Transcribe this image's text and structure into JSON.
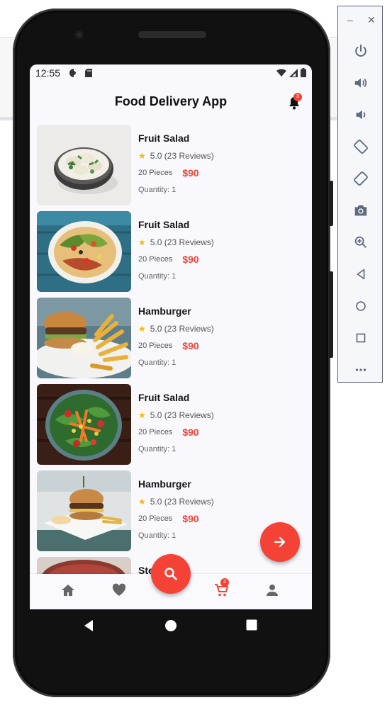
{
  "status_bar": {
    "time": "12:55"
  },
  "app": {
    "title": "Food Delivery App",
    "notification_count": "3",
    "cart_count": "3"
  },
  "items": [
    {
      "name": "Fruit Salad",
      "rating": "5.0 (23 Reviews)",
      "pieces": "20 Pieces",
      "price": "$90",
      "quantity": "Quantity: 1"
    },
    {
      "name": "Fruit Salad",
      "rating": "5.0 (23 Reviews)",
      "pieces": "20 Pieces",
      "price": "$90",
      "quantity": "Quantity: 1"
    },
    {
      "name": "Hamburger",
      "rating": "5.0 (23 Reviews)",
      "pieces": "20 Pieces",
      "price": "$90",
      "quantity": "Quantity: 1"
    },
    {
      "name": "Fruit Salad",
      "rating": "5.0 (23 Reviews)",
      "pieces": "20 Pieces",
      "price": "$90",
      "quantity": "Quantity: 1"
    },
    {
      "name": "Hamburger",
      "rating": "5.0 (23 Reviews)",
      "pieces": "20 Pieces",
      "price": "$90",
      "quantity": "Quantity: 1"
    },
    {
      "name": "Ste"
    }
  ],
  "bottom_nav": [
    "home-icon",
    "heart-icon",
    "search-icon",
    "cart-icon",
    "person-icon"
  ],
  "emulator_controls": [
    "power-icon",
    "volume-up-icon",
    "volume-down-icon",
    "rotate-left-icon",
    "rotate-right-icon",
    "camera-icon",
    "zoom-icon",
    "back-icon",
    "home-circle-icon",
    "overview-icon",
    "more-icon"
  ],
  "colors": {
    "accent": "#f44336",
    "star": "#f6b900",
    "background": "#f9f8fd"
  }
}
